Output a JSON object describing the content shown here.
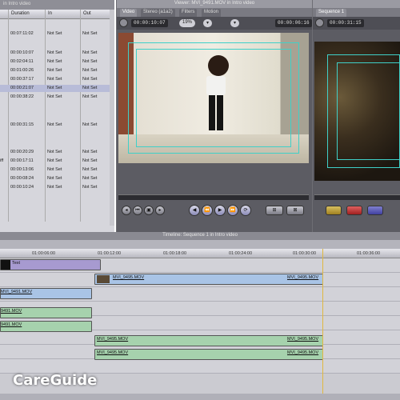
{
  "browser": {
    "title": "in Intro video",
    "columns": [
      "Duration",
      "In",
      "Out"
    ],
    "rows": [
      {
        "duration": "00:07:11:02",
        "in": "Not Set",
        "out": "Not Set",
        "selected": false
      },
      {
        "duration": "00:00:10:07",
        "in": "Not Set",
        "out": "Not Set",
        "selected": false
      },
      {
        "duration": "00:02:04:11",
        "in": "Not Set",
        "out": "Not Set",
        "selected": false
      },
      {
        "duration": "00:01:00:26",
        "in": "Not Set",
        "out": "Not Set",
        "selected": false
      },
      {
        "duration": "00:00:37:17",
        "in": "Not Set",
        "out": "Not Set",
        "selected": false
      },
      {
        "duration": "00:00:21:07",
        "in": "Not Set",
        "out": "Not Set",
        "selected": true
      },
      {
        "duration": "00:00:38:22",
        "in": "Not Set",
        "out": "Not Set",
        "selected": false
      },
      {
        "duration": "00:00:31:15",
        "in": "Not Set",
        "out": "Not Set",
        "selected": false
      },
      {
        "duration": "00:00:20:29",
        "in": "Not Set",
        "out": "Not Set",
        "selected": false
      },
      {
        "duration": "00:00:17:11",
        "in": "Not Set",
        "out": "Not Set",
        "selected": false,
        "prefix": "iff"
      },
      {
        "duration": "00:00:13:06",
        "in": "Not Set",
        "out": "Not Set",
        "selected": false
      },
      {
        "duration": "00:00:08:24",
        "in": "Not Set",
        "out": "Not Set",
        "selected": false
      },
      {
        "duration": "00:00:10:24",
        "in": "Not Set",
        "out": "Not Set",
        "selected": false
      }
    ]
  },
  "viewer": {
    "title": "Viewer: MVI_9491.MOV in Intro video",
    "tabs": [
      "Video",
      "Stereo (a1a2)",
      "Filters",
      "Motion"
    ],
    "timecode_duration": "00:00:10:07",
    "zoom": "19%",
    "timecode_current": "00:00:06:16"
  },
  "canvas": {
    "tabs": [
      "Sequence 1"
    ],
    "timecode_duration": "00:00:31:15"
  },
  "timeline": {
    "title": "Timeline: Sequence 1 in Intro video",
    "ruler": [
      "01:00:06:00",
      "01:00:12:00",
      "01:00:18:00",
      "01:00:24:00",
      "01:00:30:00",
      "01:00:36:00"
    ],
    "text_clip": "Text",
    "clips": {
      "v_upper_a": "MVI_9495.MOV",
      "v_upper_b": "MVI_9495.MOV",
      "v_lower": "MVI_9491.MOV",
      "a1_left": "9491.MOV",
      "a2_left": "9491.MOV",
      "a3_a": "MVI_9495.MOV",
      "a3_b": "MVI_9495.MOV",
      "a4_a": "MVI_9495.MOV",
      "a4_b": "MVI_9495.MOV"
    }
  },
  "watermark": "CareGuide"
}
